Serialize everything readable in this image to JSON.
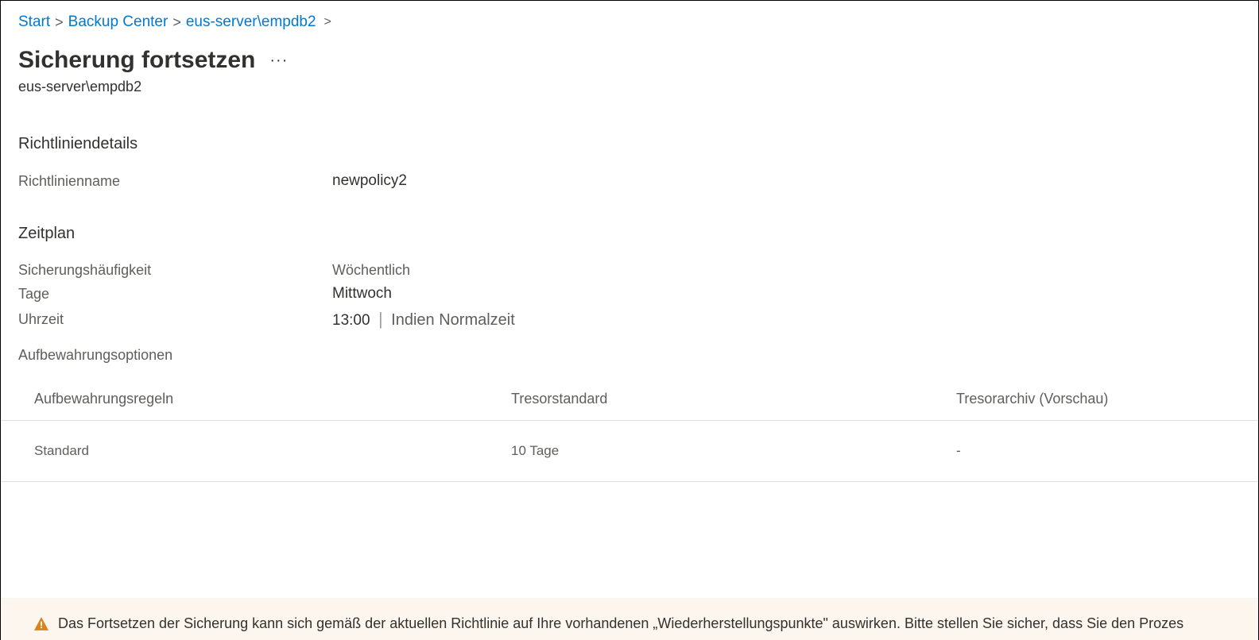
{
  "breadcrumb": {
    "items": [
      {
        "label": "Start"
      },
      {
        "label": "Backup Center"
      },
      {
        "label": "eus-server\\empdb2"
      }
    ]
  },
  "page": {
    "title": "Sicherung fortsetzen",
    "subtitle": "eus-server\\empdb2"
  },
  "policyDetails": {
    "sectionTitle": "Richtliniendetails",
    "nameLabel": "Richtlinienname",
    "nameValue": "newpolicy2"
  },
  "schedule": {
    "sectionTitle": "Zeitplan",
    "frequencyLabel": "Sicherungshäufigkeit",
    "frequencyValue": "Wöchentlich",
    "daysLabel": "Tage",
    "daysValue": "Mittwoch",
    "timeLabel": "Uhrzeit",
    "timeValue": "13:00",
    "timezoneValue": "Indien Normalzeit",
    "retentionOptionsLabel": "Aufbewahrungsoptionen"
  },
  "retentionTable": {
    "headers": {
      "rules": "Aufbewahrungsregeln",
      "standard": "Tresorstandard",
      "archive": "Tresorarchiv (Vorschau)"
    },
    "rows": [
      {
        "rule": "Standard",
        "standard": "10 Tage",
        "archive": "-"
      }
    ]
  },
  "warning": {
    "text": "Das Fortsetzen der Sicherung kann sich gemäß der aktuellen Richtlinie auf Ihre vorhandenen „Wiederherstellungspunkte\" auswirken. Bitte stellen Sie sicher, dass Sie den Prozes"
  }
}
